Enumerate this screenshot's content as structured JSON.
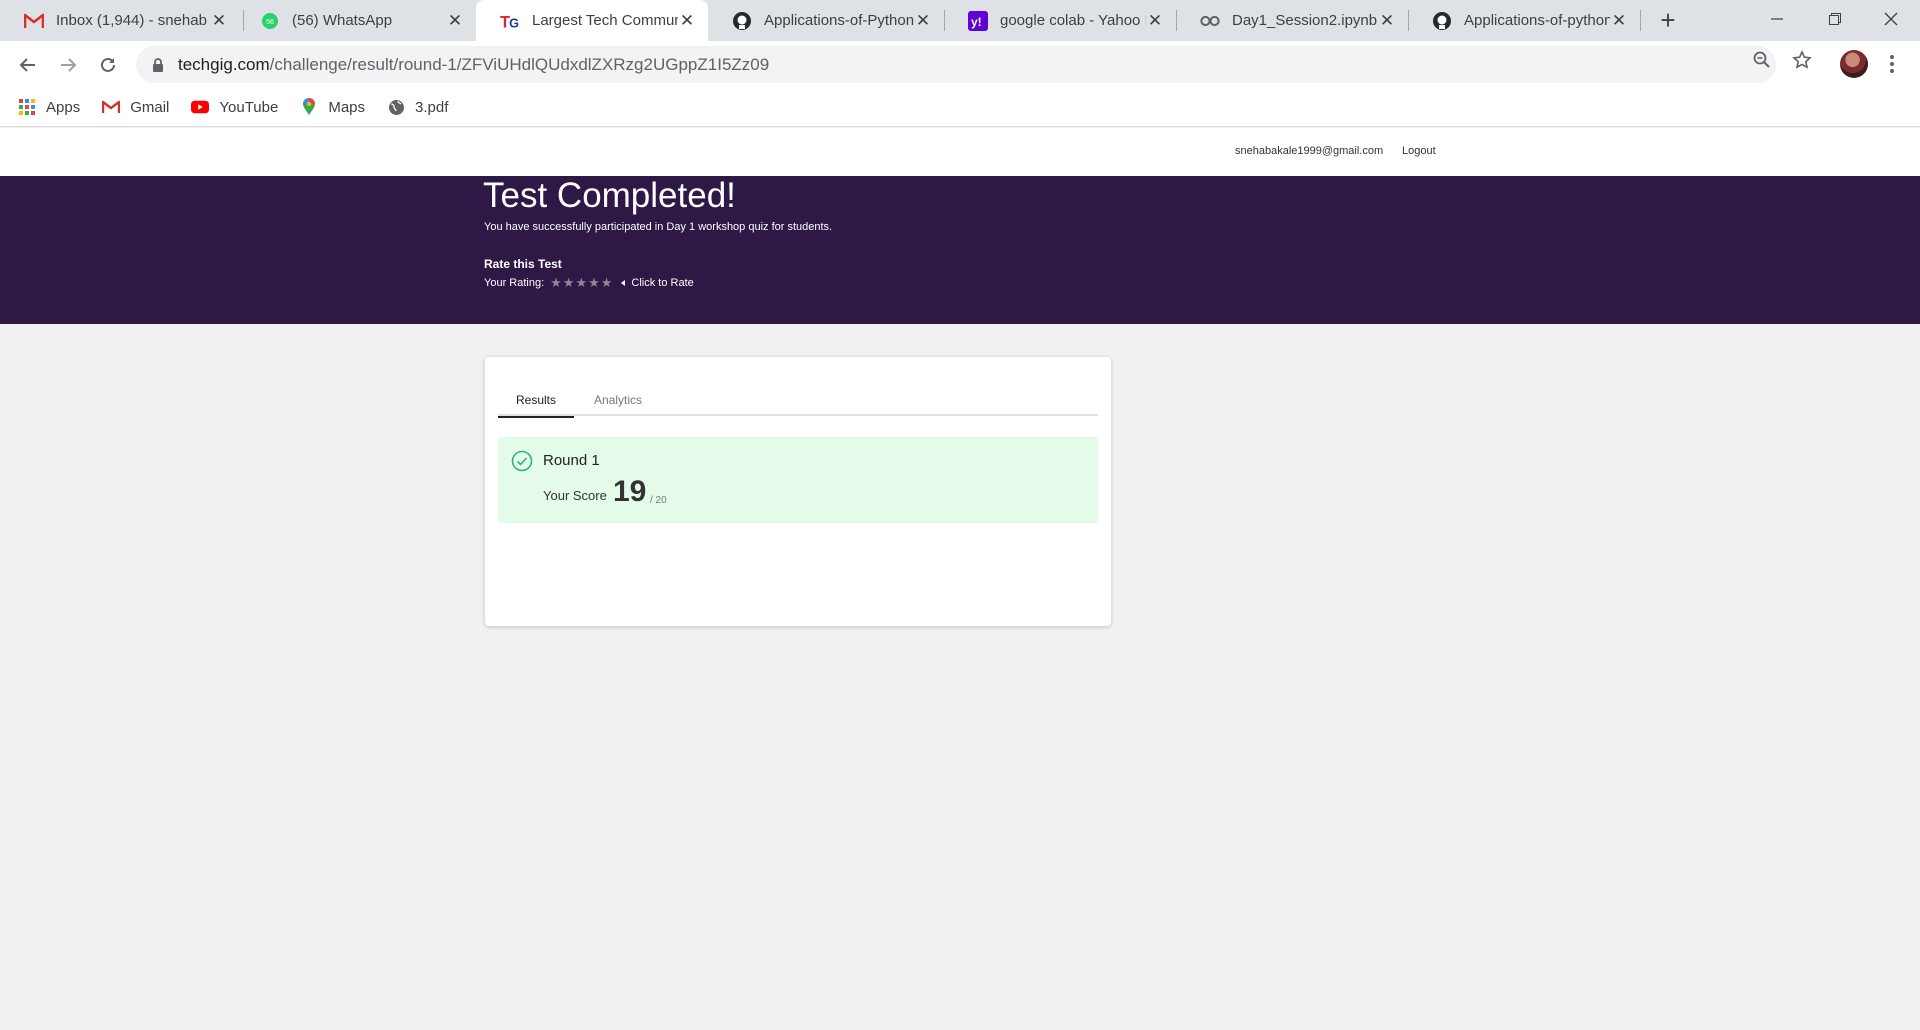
{
  "browser": {
    "tabs": [
      {
        "title": "Inbox (1,944) - snehab",
        "icon": "gmail-icon"
      },
      {
        "title": "(56) WhatsApp",
        "icon": "whatsapp-icon"
      },
      {
        "title": "Largest Tech Communi",
        "icon": "techgig-icon"
      },
      {
        "title": "Applications-of-Python",
        "icon": "github-icon"
      },
      {
        "title": "google colab - Yahoo I",
        "icon": "yahoo-icon"
      },
      {
        "title": "Day1_Session2.ipynb -",
        "icon": "colab-icon"
      },
      {
        "title": "Applications-of-python",
        "icon": "github-icon"
      }
    ],
    "active_tab": 2,
    "url_domain": "techgig.com",
    "url_path": "/challenge/result/round-1/ZFViUHdlQUdxdlZXRzg2UGppZ1I5Zz09",
    "bookmarks": [
      {
        "label": "Apps",
        "icon": "apps-grid-icon"
      },
      {
        "label": "Gmail",
        "icon": "gmail-icon"
      },
      {
        "label": "YouTube",
        "icon": "youtube-icon"
      },
      {
        "label": "Maps",
        "icon": "maps-pin-icon"
      },
      {
        "label": "3.pdf",
        "icon": "globe-icon"
      }
    ]
  },
  "site": {
    "user_email": "snehabakale1999@gmail.com",
    "logout_label": "Logout"
  },
  "banner": {
    "title": "Test Completed!",
    "subtitle": "You have successfully participated in Day 1 workshop quiz for students.",
    "rate_title": "Rate this Test",
    "rating_label": "Your Rating:",
    "click_to_rate": "Click to Rate",
    "rating_value": 0,
    "rating_max": 5
  },
  "card": {
    "tabs": [
      {
        "label": "Results",
        "active": true
      },
      {
        "label": "Analytics",
        "active": false
      }
    ],
    "result": {
      "round": "Round 1",
      "score_label": "Your Score",
      "score": "19",
      "total": "/ 20"
    }
  },
  "colors": {
    "banner_bg": "#2d1846",
    "result_bg": "#e4fbea",
    "check_green": "#2bb673",
    "page_bg": "#f1f1f1"
  }
}
